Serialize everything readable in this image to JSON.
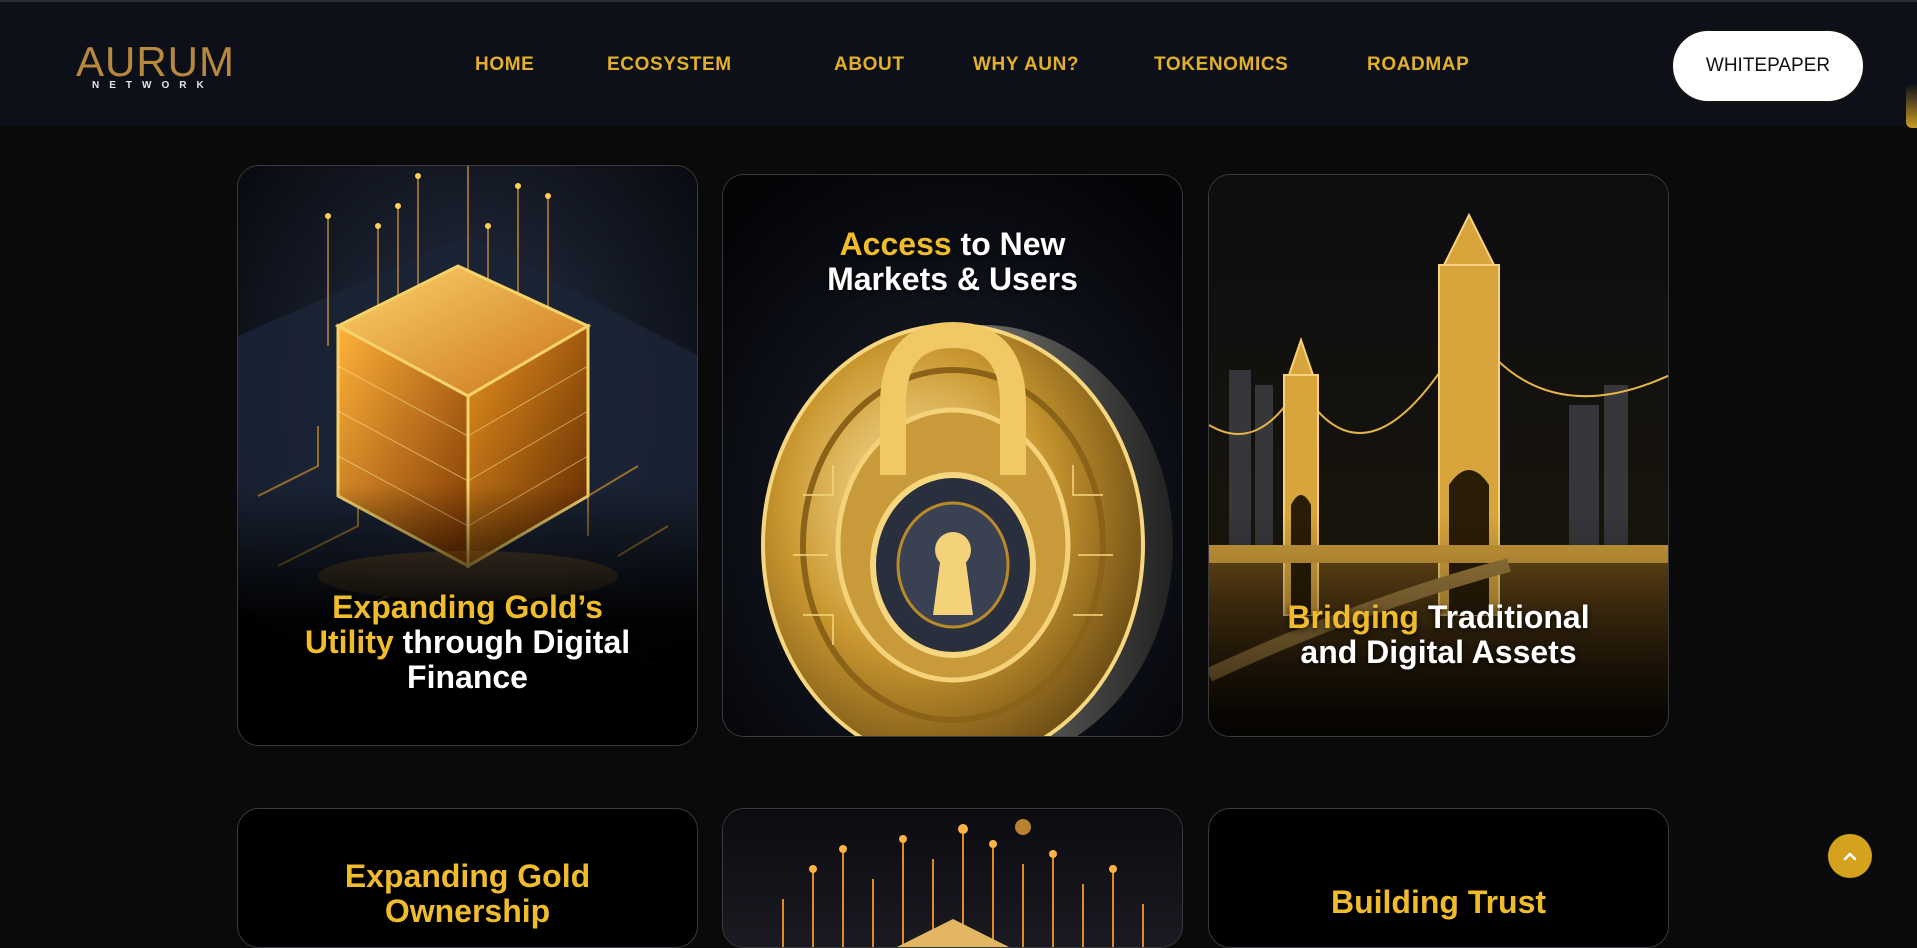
{
  "brand": {
    "name": "AURUM",
    "tagline": "NETWORK"
  },
  "nav": {
    "home": "HOME",
    "ecosystem": "ECOSYSTEM",
    "about": "ABOUT",
    "why": "WHY AUN?",
    "tokenomics": "TOKENOMICS",
    "roadmap": "ROADMAP"
  },
  "cta": {
    "whitepaper": "WHITEPAPER"
  },
  "cards": [
    {
      "highlight": "Expanding Gold’s",
      "highlight2": "Utility",
      "rest": " through Digital",
      "rest2": "Finance",
      "image": "gold-cube-circuit"
    },
    {
      "highlight": "Access",
      "rest": " to New",
      "rest2": "Markets & Users",
      "image": "gold-padlock-coin"
    },
    {
      "highlight": "Bridging",
      "rest": " Traditional",
      "rest2": "and Digital Assets",
      "image": "golden-bridge"
    },
    {
      "highlight": "Expanding Gold",
      "highlight2": "Ownership",
      "image": "dark"
    },
    {
      "image": "gold-circuit-city"
    },
    {
      "highlight": "Building Trust",
      "image": "dark"
    }
  ],
  "icons": {
    "back_to_top": "chevron-up-icon"
  },
  "colors": {
    "accent": "#f0bc2c",
    "nav_text": "#e3b02b",
    "background": "#0a0a0a",
    "navbar": "#0e1019"
  }
}
